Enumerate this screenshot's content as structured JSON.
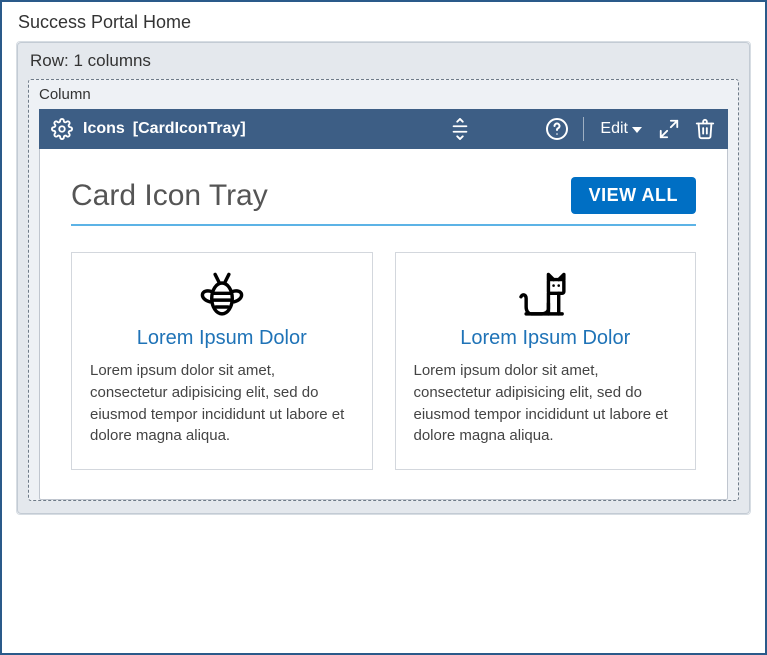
{
  "page": {
    "title": "Success Portal Home"
  },
  "row": {
    "label": "Row: 1 columns"
  },
  "column": {
    "label": "Column"
  },
  "widget": {
    "toolbar": {
      "title": "Icons",
      "subtitle": "[CardIconTray]",
      "edit_label": "Edit"
    },
    "body": {
      "title": "Card Icon Tray",
      "view_all": "VIEW ALL"
    },
    "cards": [
      {
        "icon": "bee-icon",
        "title": "Lorem Ipsum Dolor",
        "text": "Lorem ipsum dolor sit amet, consectetur adipisicing elit, sed do eiusmod tempor incididunt ut labore et dolore magna aliqua."
      },
      {
        "icon": "cat-icon",
        "title": "Lorem Ipsum Dolor",
        "text": "Lorem ipsum dolor sit amet, consectetur adipisicing elit, sed do eiusmod tempor incididunt ut labore et dolore magna aliqua."
      }
    ]
  }
}
